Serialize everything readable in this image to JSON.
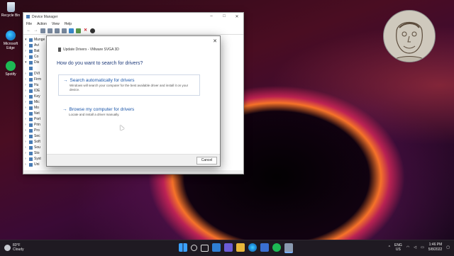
{
  "desktop": {
    "icons": [
      {
        "label": "Recycle Bin",
        "icon": "recycle-bin-icon"
      },
      {
        "label": "Microsoft Edge",
        "icon": "edge-icon"
      },
      {
        "label": "Spotify",
        "icon": "spotify-icon"
      }
    ]
  },
  "device_manager": {
    "title": "Device Manager",
    "menu": [
      "File",
      "Action",
      "View",
      "Help"
    ],
    "tree": [
      {
        "label": "Munge",
        "expanded": true
      },
      {
        "label": "Avi",
        "expanded": false
      },
      {
        "label": "Bat",
        "expanded": false
      },
      {
        "label": "Co",
        "expanded": false
      },
      {
        "label": "Dis",
        "expanded": true
      },
      {
        "label": "",
        "expanded": false
      },
      {
        "label": "DVI",
        "expanded": false
      },
      {
        "label": "Firm",
        "expanded": false
      },
      {
        "label": "Hu",
        "expanded": false
      },
      {
        "label": "IDE",
        "expanded": false
      },
      {
        "label": "Key",
        "expanded": false
      },
      {
        "label": "Mic",
        "expanded": false
      },
      {
        "label": "Mo",
        "expanded": false
      },
      {
        "label": "Net",
        "expanded": false
      },
      {
        "label": "Port",
        "expanded": false
      },
      {
        "label": "Prin",
        "expanded": false
      },
      {
        "label": "Pro",
        "expanded": false
      },
      {
        "label": "Sec",
        "expanded": false
      },
      {
        "label": "Soft",
        "expanded": false
      },
      {
        "label": "Sou",
        "expanded": false
      },
      {
        "label": "Sto",
        "expanded": false
      },
      {
        "label": "Syst",
        "expanded": false
      },
      {
        "label": "Uni",
        "expanded": false
      }
    ]
  },
  "dialog": {
    "header": "Update Drivers - VMware SVGA 3D",
    "question": "How do you want to search for drivers?",
    "option1": {
      "title": "Search automatically for drivers",
      "desc": "Windows will search your computer for the best available driver and install it on your device."
    },
    "option2": {
      "title": "Browse my computer for drivers",
      "desc": "Locate and install a driver manually."
    },
    "cancel_label": "Cancel"
  },
  "taskbar": {
    "weather_temp": "83°F",
    "weather_desc": "Cloudy",
    "lang_line1": "ENG",
    "lang_line2": "US",
    "time": "1:46 PM",
    "date": "5/8/2022"
  },
  "colors": {
    "accent_link": "#1a55a8",
    "taskbar_bg": "#1f1a22"
  }
}
